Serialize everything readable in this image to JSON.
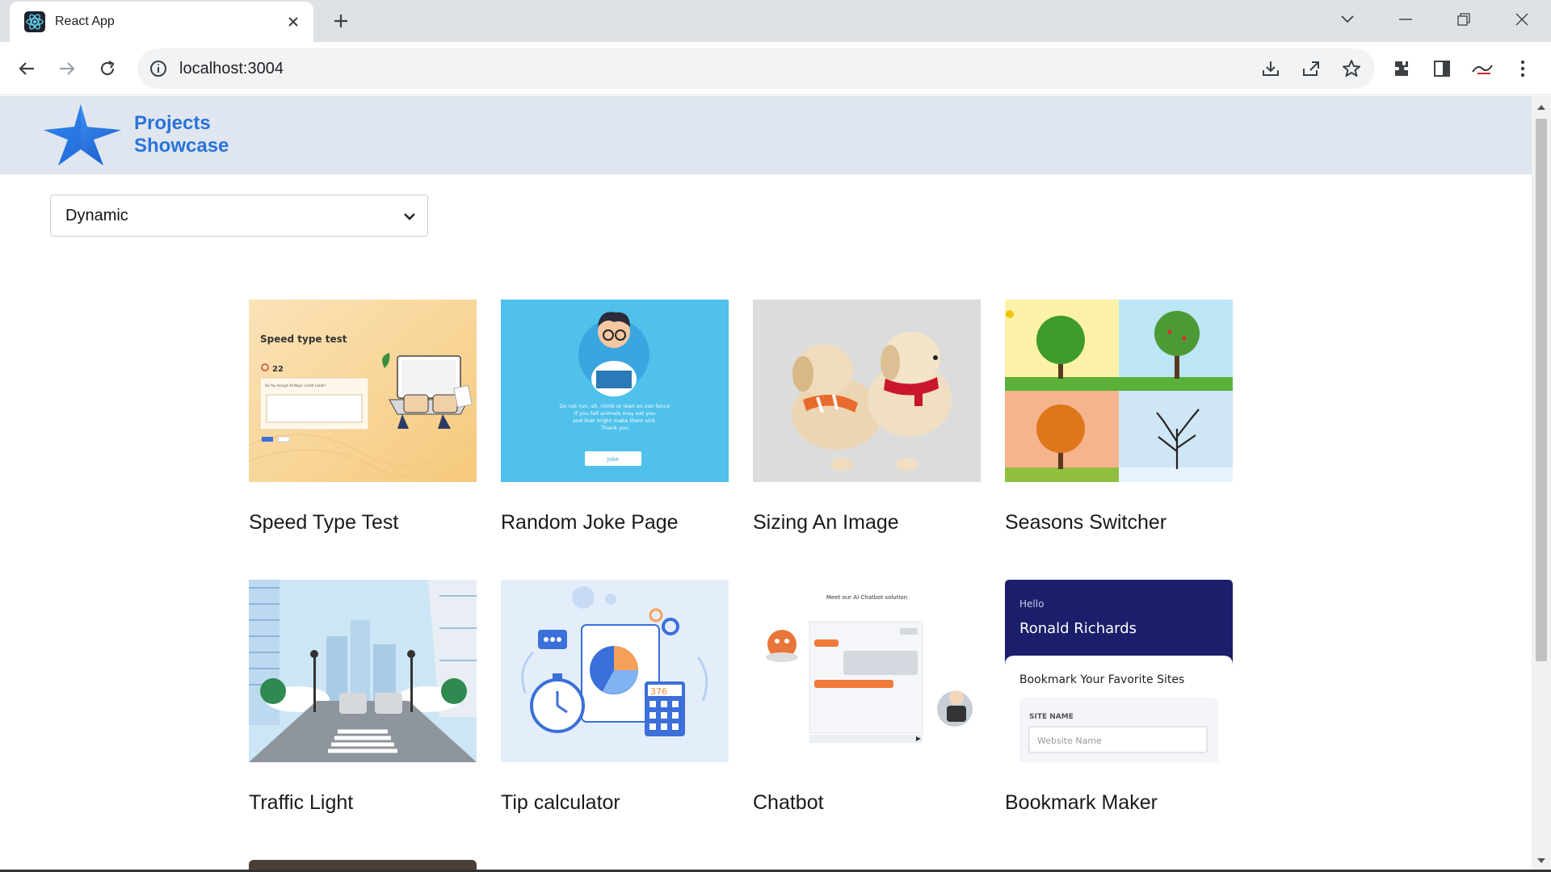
{
  "browser": {
    "tab_title": "React App",
    "url": "localhost:3004"
  },
  "header": {
    "brand_line1": "Projects",
    "brand_line2": "Showcase"
  },
  "filter": {
    "selected": "Dynamic"
  },
  "projects": [
    {
      "title": "Speed Type Test",
      "thumb_heading": "Speed type test",
      "thumb_count": "22",
      "thumb_question": "Do You Accept All Major Credit Cards?"
    },
    {
      "title": "Random Joke Page",
      "thumb_text1": "Do not run, sit, climb or lean on zoo fence",
      "thumb_text2": "If you fall animals may eat you",
      "thumb_text3": "and that might make them sick.",
      "thumb_text4": "Thank you",
      "thumb_button": "Joke"
    },
    {
      "title": "Sizing An Image"
    },
    {
      "title": "Seasons Switcher"
    },
    {
      "title": "Traffic Light"
    },
    {
      "title": "Tip calculator",
      "thumb_number": "376"
    },
    {
      "title": "Chatbot",
      "thumb_heading": "Meet our AI Chatbot solution"
    },
    {
      "title": "Bookmark Maker",
      "thumb_hello": "Hello",
      "thumb_name": "Ronald Richards",
      "thumb_heading": "Bookmark Your Favorite Sites",
      "thumb_label": "SITE NAME",
      "thumb_placeholder": "Website Name"
    }
  ],
  "colors": {
    "brand": "#2a73d9",
    "header_bg": "#e0e6ef",
    "bookmark_navy": "#1b1f6b"
  }
}
